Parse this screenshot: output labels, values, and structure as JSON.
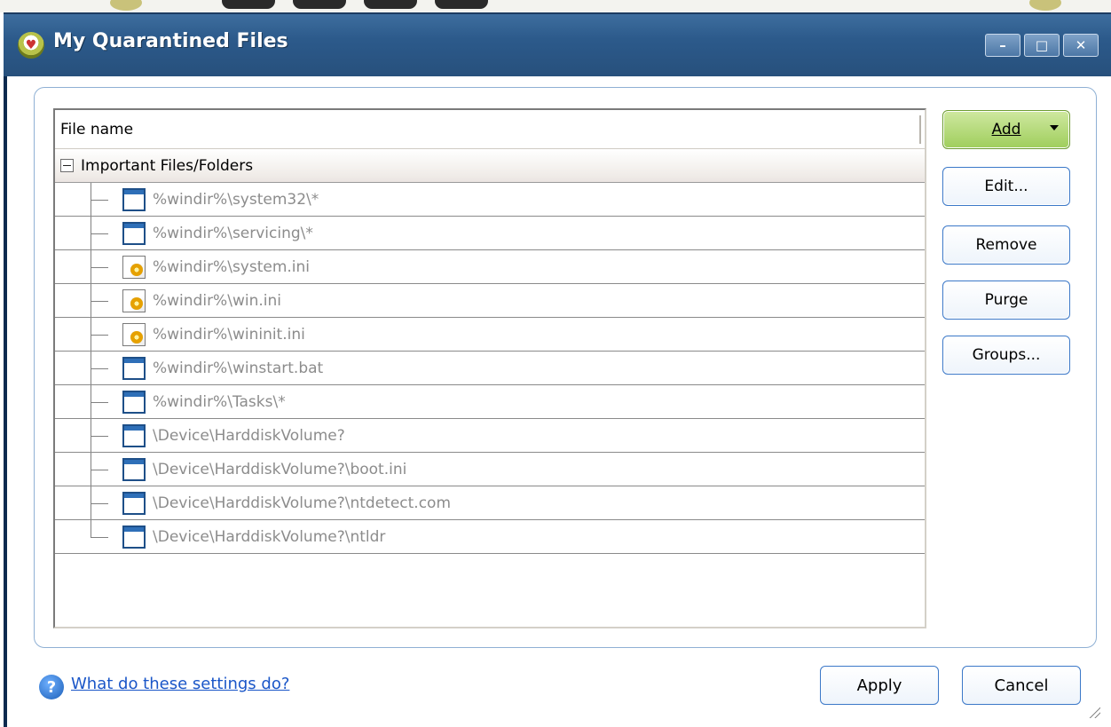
{
  "window": {
    "title": "My Quarantined Files"
  },
  "list": {
    "column_header": "File name",
    "group": {
      "label": "Important Files/Folders",
      "expanded": true
    },
    "items": [
      {
        "path": "%windir%\\system32\\*",
        "icon": "window-file-icon"
      },
      {
        "path": "%windir%\\servicing\\*",
        "icon": "window-file-icon"
      },
      {
        "path": "%windir%\\system.ini",
        "icon": "ini-file-icon"
      },
      {
        "path": "%windir%\\win.ini",
        "icon": "ini-file-icon"
      },
      {
        "path": "%windir%\\wininit.ini",
        "icon": "ini-file-icon"
      },
      {
        "path": "%windir%\\winstart.bat",
        "icon": "window-file-icon"
      },
      {
        "path": "%windir%\\Tasks\\*",
        "icon": "window-file-icon"
      },
      {
        "path": "\\Device\\HarddiskVolume?",
        "icon": "window-file-icon"
      },
      {
        "path": "\\Device\\HarddiskVolume?\\boot.ini",
        "icon": "window-file-icon"
      },
      {
        "path": "\\Device\\HarddiskVolume?\\ntdetect.com",
        "icon": "window-file-icon"
      },
      {
        "path": "\\Device\\HarddiskVolume?\\ntldr",
        "icon": "window-file-icon"
      }
    ]
  },
  "buttons": {
    "add": "Add",
    "edit": "Edit...",
    "remove": "Remove",
    "purge": "Purge",
    "groups": "Groups...",
    "apply": "Apply",
    "cancel": "Cancel"
  },
  "footer": {
    "help_link": "What do these settings do?"
  },
  "colors": {
    "titlebar": "#2c5a8b",
    "add_button": "#9fce5c",
    "button_border": "#3b78c8",
    "disabled_text": "#8c8c8c",
    "link": "#1a56c8"
  }
}
